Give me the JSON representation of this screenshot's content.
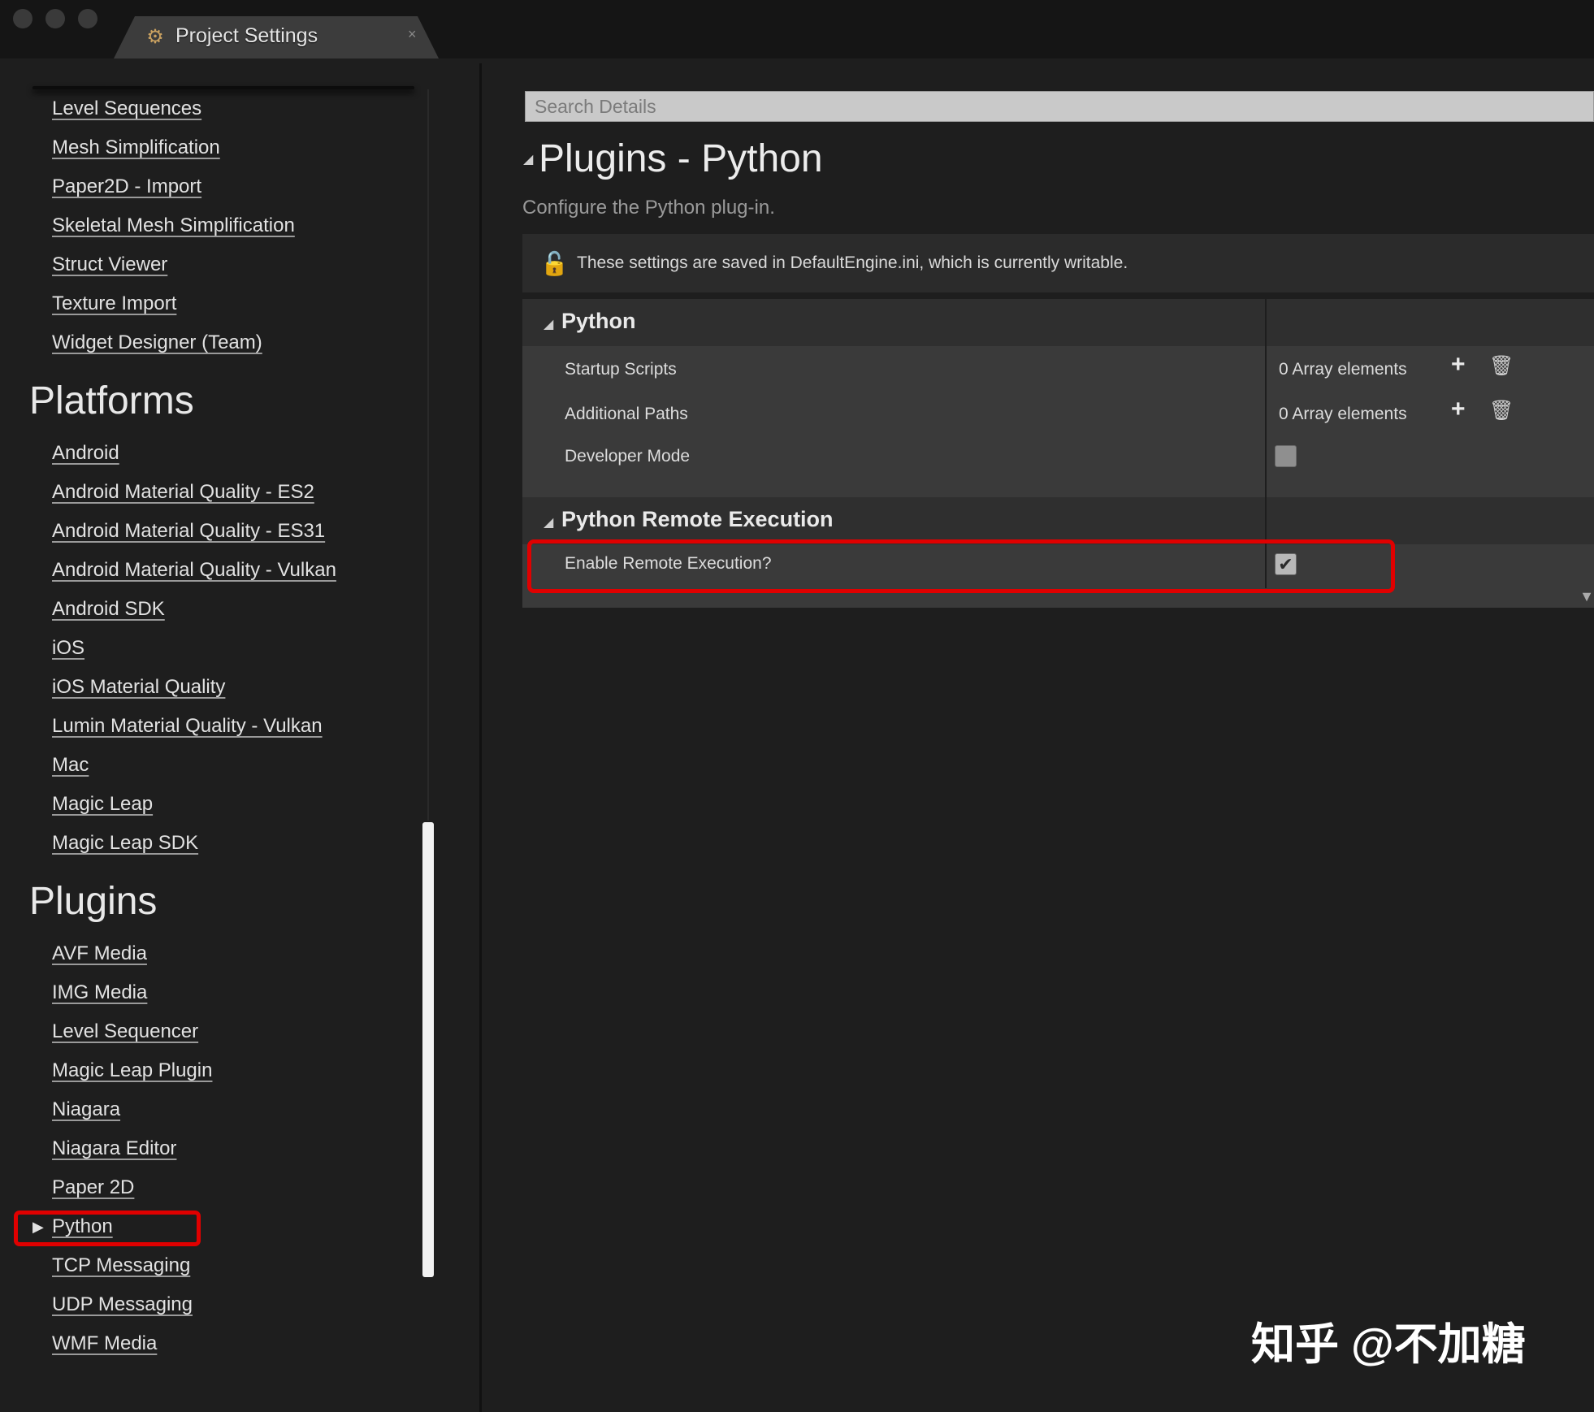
{
  "window": {
    "tab_title": "Project Settings",
    "tab_icon": "project-settings-icon",
    "close_glyph": "×"
  },
  "sidebar": {
    "editor_items": [
      "Level Sequences",
      "Mesh Simplification",
      "Paper2D - Import",
      "Skeletal Mesh Simplification",
      "Struct Viewer",
      "Texture Import",
      "Widget Designer (Team)"
    ],
    "platforms_heading": "Platforms",
    "platform_items": [
      "Android",
      "Android Material Quality - ES2",
      "Android Material Quality - ES31",
      "Android Material Quality - Vulkan",
      "Android SDK",
      "iOS",
      "iOS Material Quality",
      "Lumin Material Quality - Vulkan",
      "Mac",
      "Magic Leap",
      "Magic Leap SDK"
    ],
    "plugins_heading": "Plugins",
    "plugin_items": [
      "AVF Media",
      "IMG Media",
      "Level Sequencer",
      "Magic Leap Plugin",
      "Niagara",
      "Niagara Editor",
      "Paper 2D",
      "Python",
      "TCP Messaging",
      "UDP Messaging",
      "WMF Media"
    ],
    "selected_item": "Python"
  },
  "details": {
    "search_placeholder": "Search Details",
    "title": "Plugins - Python",
    "description": "Configure the Python plug-in.",
    "info_text": "These settings are saved in DefaultEngine.ini, which is currently writable.",
    "sections": [
      {
        "title": "Python",
        "properties": [
          {
            "label": "Startup Scripts",
            "value": "0 Array elements"
          },
          {
            "label": "Additional Paths",
            "value": "0 Array elements"
          },
          {
            "label": "Developer Mode",
            "checked": false
          }
        ]
      },
      {
        "title": "Python Remote Execution",
        "properties": [
          {
            "label": "Enable Remote Execution?",
            "checked": true
          }
        ]
      }
    ]
  },
  "icons": {
    "add": "+",
    "delete": "🗑",
    "lock": "🔓",
    "collapse": "◢",
    "expand_right": "▶",
    "check": "✔"
  },
  "watermark": "知乎 @不加糖",
  "colors": {
    "background": "#1e1e1e",
    "highlight": "#e00000",
    "row": "#3a3a3a"
  }
}
